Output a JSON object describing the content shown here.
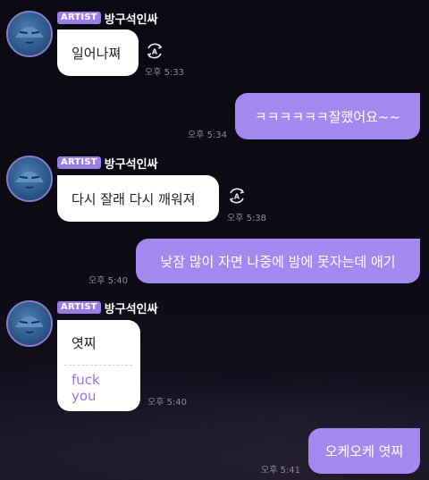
{
  "artist_badge": "ARTIST",
  "artist_name": "방구석인싸",
  "messages": [
    {
      "text": "일어나쪄",
      "time": "오후 5:33"
    },
    {
      "text": "ㅋㅋㅋㅋㅋㅋ잘했어요~~",
      "time": "오후 5:34"
    },
    {
      "text": "다시 잘래 다시 깨워져",
      "time": "오후 5:38"
    },
    {
      "text": "낮잠 많이 자면 나중에 밤에 못자는데 애기",
      "time": "오후 5:40"
    },
    {
      "text": "엿찌",
      "translation": "fuck you",
      "time": "오후 5:40"
    },
    {
      "text": "오케오케 엿찌",
      "time": "오후 5:41"
    }
  ],
  "colors": {
    "outgoing_bubble": "#a588ef",
    "incoming_bubble": "#ffffff",
    "badge": "#9a7ee6",
    "translation_text": "#9a72de"
  },
  "icons": {
    "avatar": "avatar-icon",
    "translate": "translate-icon"
  }
}
